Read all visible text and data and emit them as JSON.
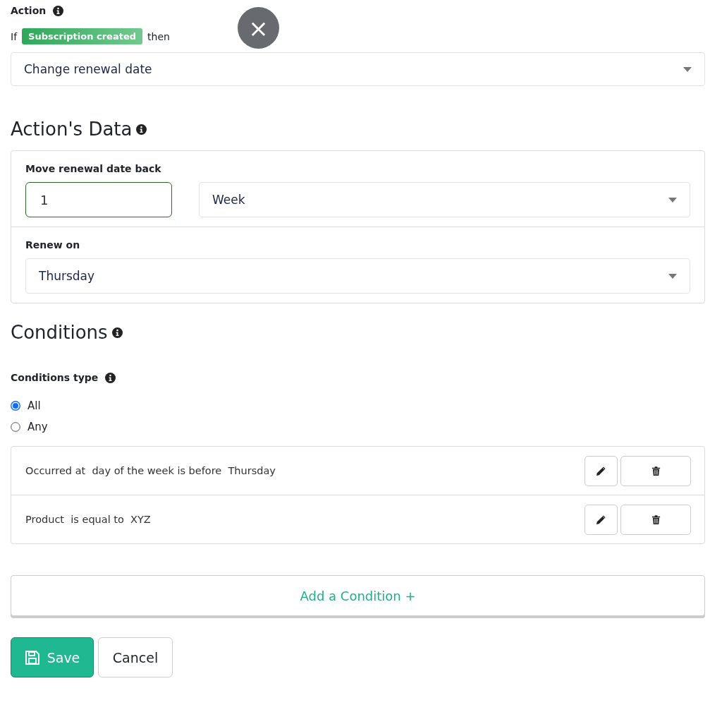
{
  "action": {
    "label": "Action",
    "if_text": "If",
    "trigger_badge": "Subscription created",
    "then_text": "then",
    "select_value": "Change renewal date"
  },
  "close_button": {
    "symbol": "×"
  },
  "actions_data": {
    "heading": "Action's Data",
    "move_label": "Move renewal date back",
    "amount_value": "1",
    "unit_value": "Week",
    "renew_label": "Renew on",
    "renew_value": "Thursday"
  },
  "conditions": {
    "heading": "Conditions",
    "type_label": "Conditions type",
    "options": [
      {
        "label": "All",
        "selected": true
      },
      {
        "label": "Any",
        "selected": false
      }
    ],
    "items": [
      {
        "text": "Occurred at  day of the week is before  Thursday"
      },
      {
        "text": "Product  is equal to  XYZ"
      }
    ],
    "add_button": "Add a Condition +"
  },
  "buttons": {
    "save": "Save",
    "cancel": "Cancel"
  }
}
